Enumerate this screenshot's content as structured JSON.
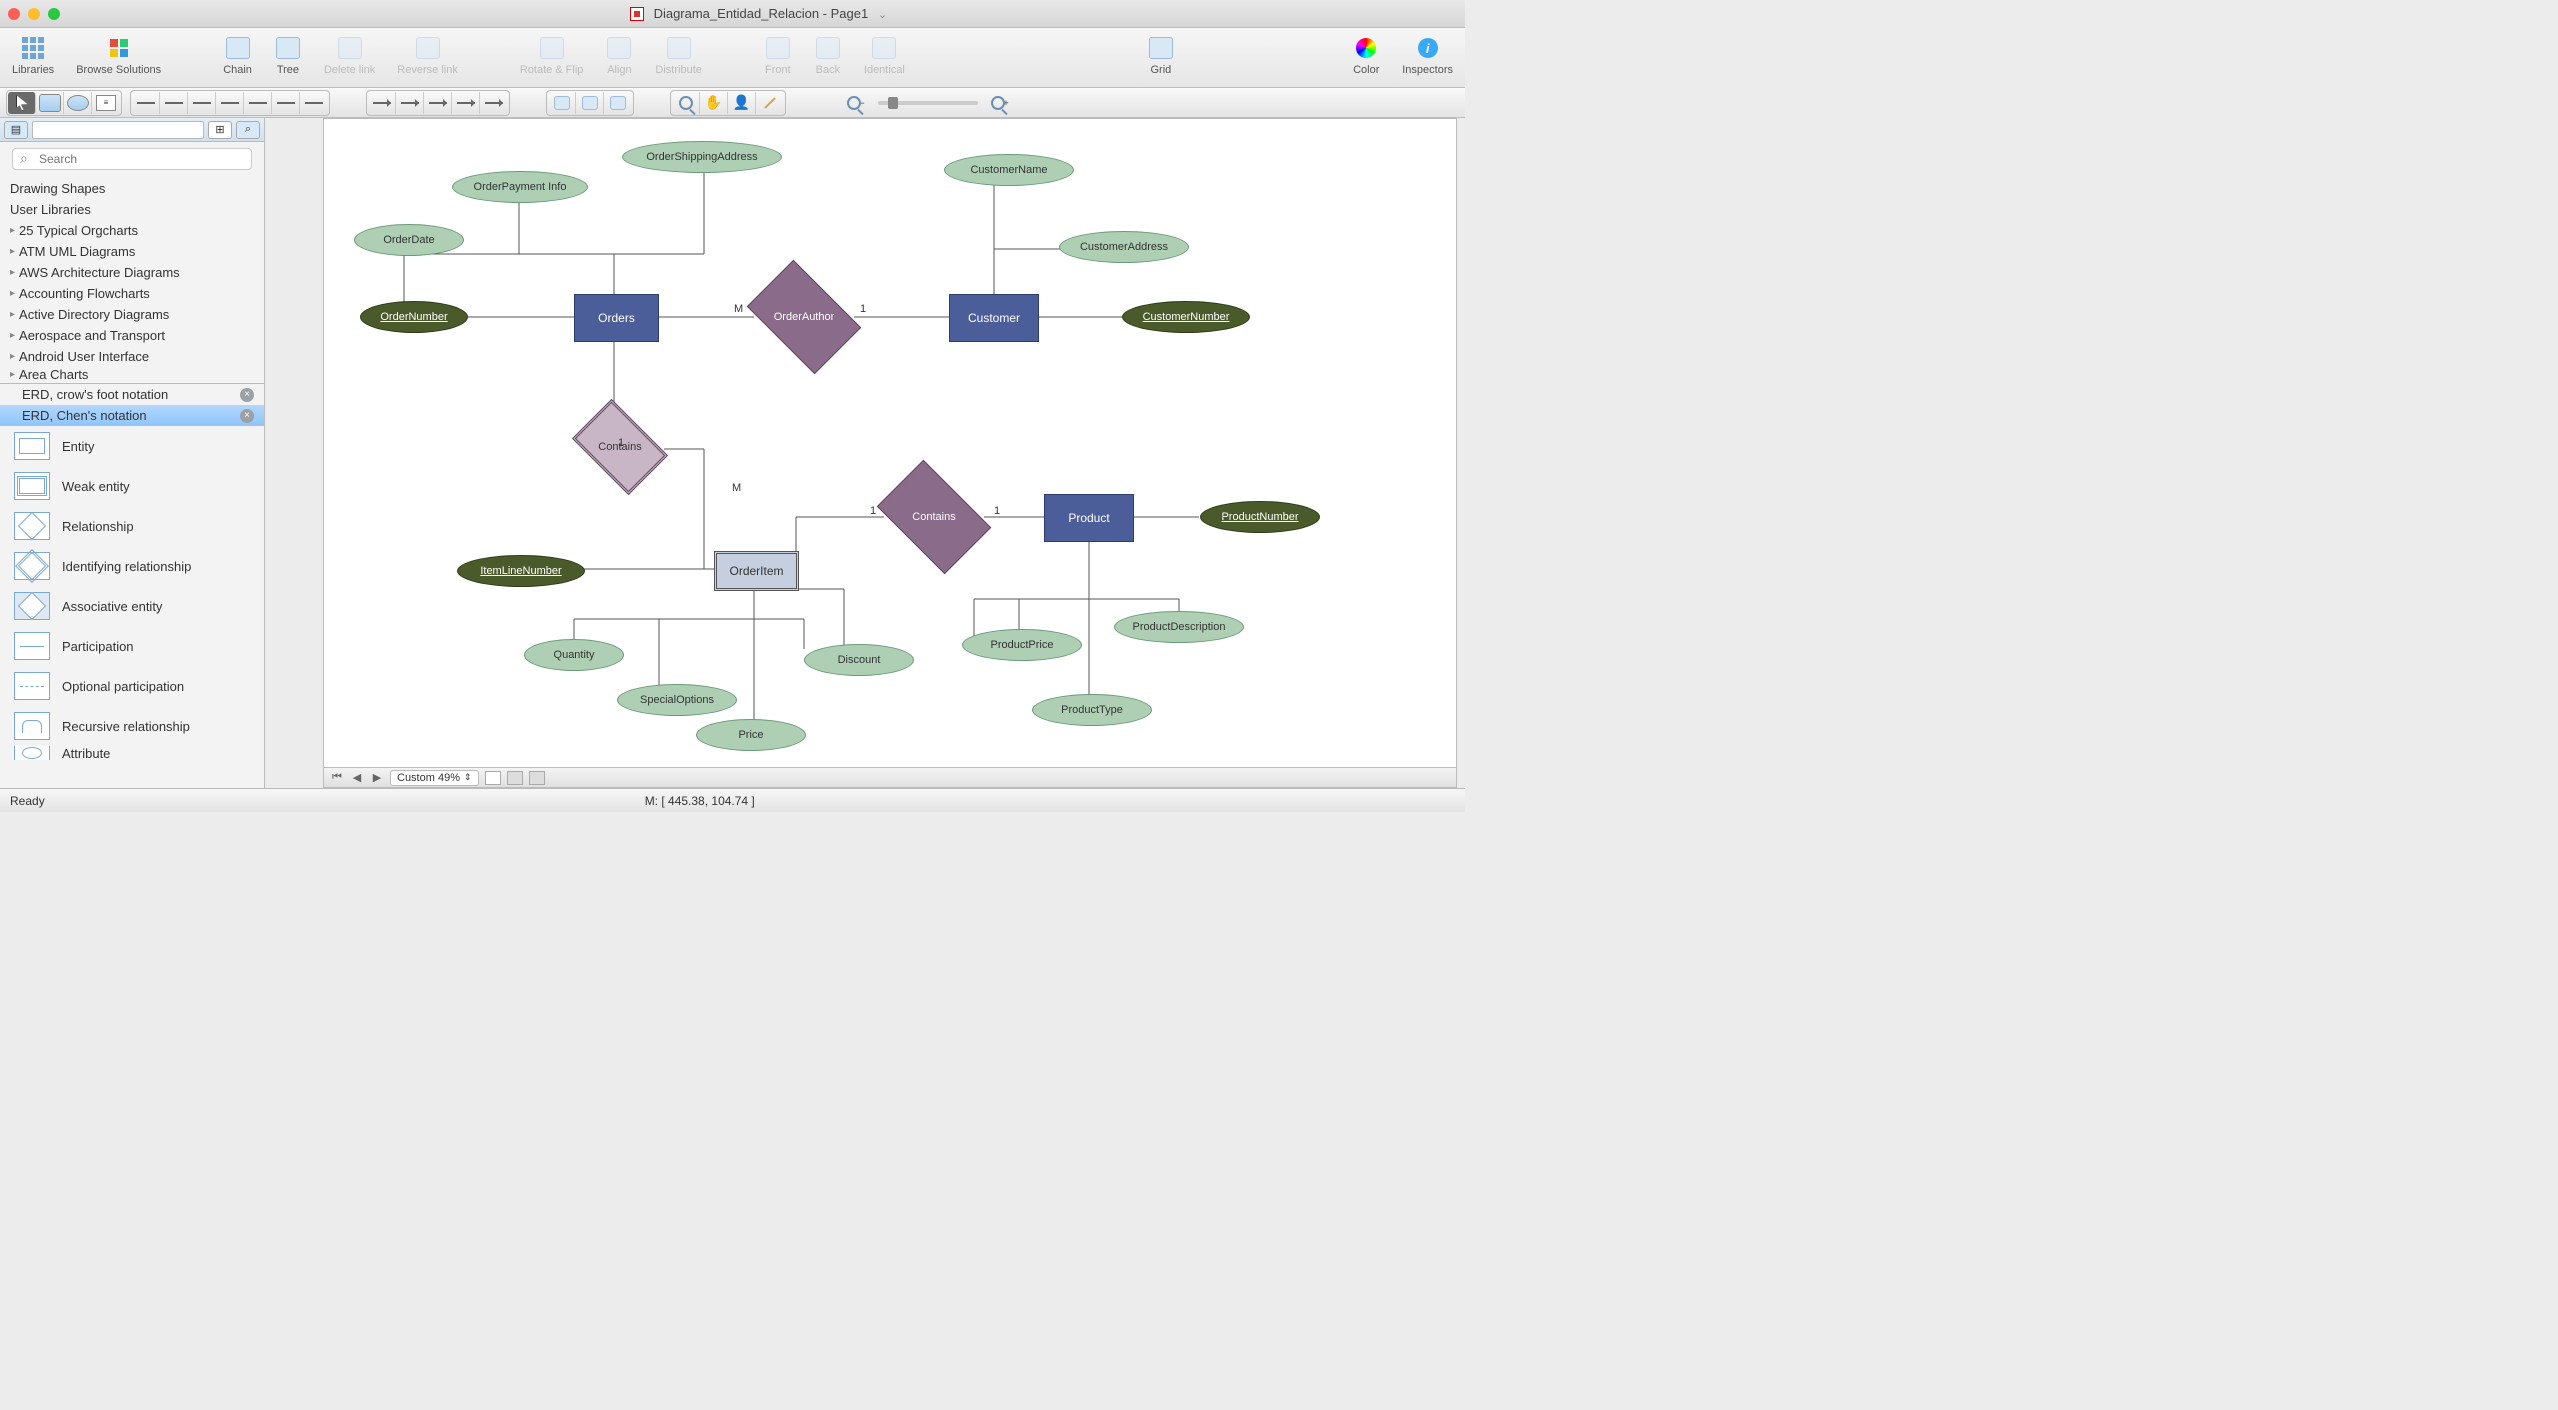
{
  "title": "Diagrama_Entidad_Relacion - Page1",
  "toolbar": {
    "libraries": "Libraries",
    "browse": "Browse Solutions",
    "chain": "Chain",
    "tree": "Tree",
    "delete_link": "Delete link",
    "reverse_link": "Reverse link",
    "rotate_flip": "Rotate & Flip",
    "align": "Align",
    "distribute": "Distribute",
    "front": "Front",
    "back": "Back",
    "identical": "Identical",
    "grid": "Grid",
    "color": "Color",
    "inspectors": "Inspectors"
  },
  "search_placeholder": "Search",
  "sidebar_categories": [
    "Drawing Shapes",
    "User Libraries",
    "25 Typical Orgcharts",
    "ATM UML Diagrams",
    "AWS Architecture Diagrams",
    "Accounting Flowcharts",
    "Active Directory Diagrams",
    "Aerospace and Transport",
    "Android User Interface",
    "Area Charts"
  ],
  "sidebar_tabs": {
    "crowfoot": "ERD, crow's foot notation",
    "chen": "ERD, Chen's notation"
  },
  "shapes": {
    "entity": "Entity",
    "weak_entity": "Weak entity",
    "relationship": "Relationship",
    "identifying": "Identifying relationship",
    "associative": "Associative entity",
    "participation": "Participation",
    "optional": "Optional participation",
    "recursive": "Recursive relationship",
    "attribute": "Attribute"
  },
  "diagram": {
    "orders": "Orders",
    "customer": "Customer",
    "product": "Product",
    "orderitem": "OrderItem",
    "order_number": "OrderNumber",
    "order_date": "OrderDate",
    "order_payment": "OrderPayment Info",
    "order_shipping": "OrderShippingAddress",
    "customer_name": "CustomerName",
    "customer_address": "CustomerAddress",
    "customer_number": "CustomerNumber",
    "item_line": "ItemLineNumber",
    "quantity": "Quantity",
    "special_options": "SpecialOptions",
    "price": "Price",
    "discount": "Discount",
    "product_number": "ProductNumber",
    "product_price": "ProductPrice",
    "product_description": "ProductDescription",
    "product_type": "ProductType",
    "order_author": "OrderAuthor",
    "contains": "Contains",
    "card_m": "M",
    "card_1": "1"
  },
  "zoom_label": "Custom 49%",
  "status_ready": "Ready",
  "status_coords": "M: [ 445.38, 104.74 ]"
}
